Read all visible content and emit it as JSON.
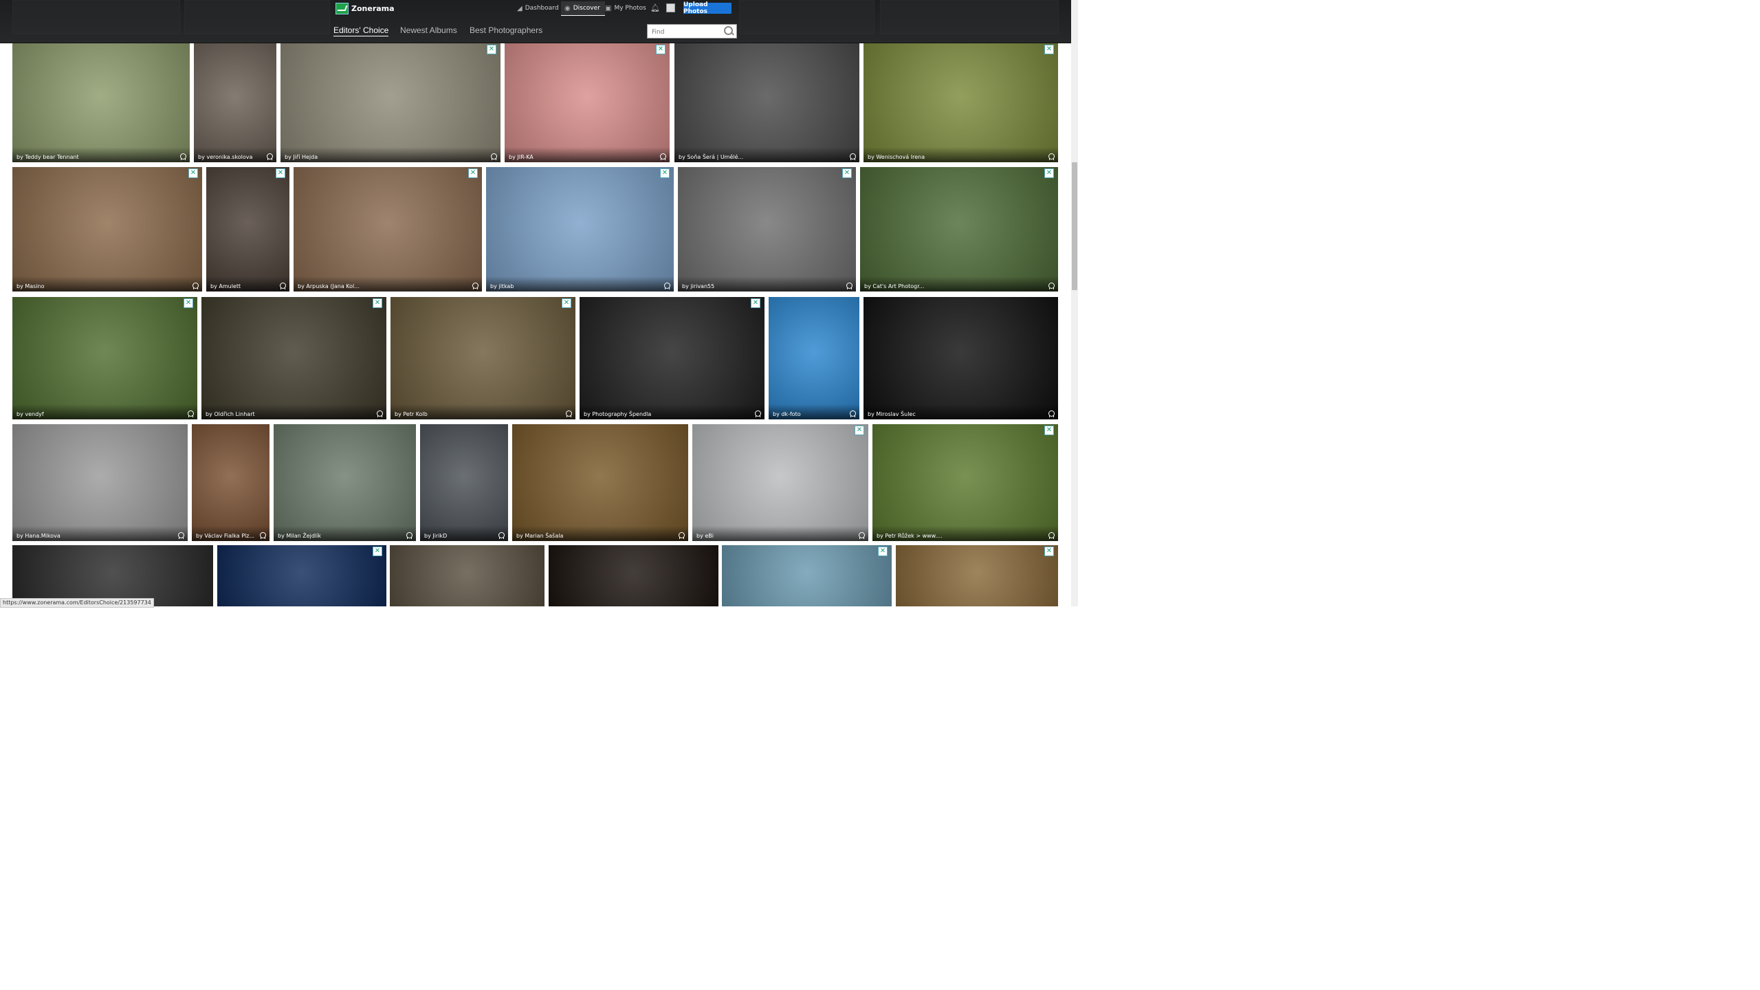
{
  "header": {
    "logo_text": "Zonerama",
    "nav": {
      "dashboard": "Dashboard",
      "discover": "Discover",
      "my_photos": "My Photos"
    },
    "upload_label": "Upload Photos",
    "tabs": {
      "editors": "Editors' Choice",
      "newest": "Newest Albums",
      "best": "Best Photographers"
    },
    "search_placeholder": "Find"
  },
  "tiles": [
    {
      "by": "by Teddy bear Tennant",
      "color": "#8b9b6a"
    },
    {
      "by": "by veronika.skolova",
      "color": "#6a5f55"
    },
    {
      "by": "by Jiří Hejda",
      "color": "#8f8a78"
    },
    {
      "by": "by JIR-KA",
      "color": "#d98d8a"
    },
    {
      "by": "by Soňa Šerá | Umělé...",
      "color": "#4a4a4a"
    },
    {
      "by": "by Wenischová Irena",
      "color": "#7a8a3a"
    },
    {
      "by": "by Masino",
      "color": "#8b6a4a"
    },
    {
      "by": "by Amulett",
      "color": "#4a3e36"
    },
    {
      "by": "by Arpuska (Jana Kol...",
      "color": "#8a6a4f"
    },
    {
      "by": "by jitkab",
      "color": "#7aa0c8"
    },
    {
      "by": "by jirivan55",
      "color": "#6f6f6f"
    },
    {
      "by": "by Cat's Art Photogr...",
      "color": "#4d6b36"
    },
    {
      "by": "by vendyf",
      "color": "#4f6e2f"
    },
    {
      "by": "by Oldřich Linhart",
      "color": "#3e3a2a"
    },
    {
      "by": "by Petr Kolb",
      "color": "#6a5a3a"
    },
    {
      "by": "by Photography Špendla",
      "color": "#1e1e1e"
    },
    {
      "by": "by dk-foto",
      "color": "#2a86d0"
    },
    {
      "by": "by Miroslav Šulec",
      "color": "#0f0f0f"
    },
    {
      "by": "by Hana.Mikova",
      "color": "#9a9a9a"
    },
    {
      "by": "by Václav Fialka Plz...",
      "color": "#7a5032"
    },
    {
      "by": "by Milan Žejdlík",
      "color": "#6b7a6a"
    },
    {
      "by": "by JirikD",
      "color": "#4a5056"
    },
    {
      "by": "by Marian Šašala",
      "color": "#7a5a2a"
    },
    {
      "by": "by eBi",
      "color": "#b9bcbe"
    },
    {
      "by": "by Petr Růžek > www....",
      "color": "#5c7a2e"
    },
    {
      "by": "",
      "color": "#2a2a2a"
    },
    {
      "by": "",
      "color": "#0f2a5a"
    },
    {
      "by": "",
      "color": "#5a5040"
    },
    {
      "by": "",
      "color": "#1c1410"
    },
    {
      "by": "",
      "color": "#6a9ab0"
    },
    {
      "by": "",
      "color": "#8a6a3a"
    }
  ],
  "status_url": "https://www.zonerama.com/EditorsChoice/213597734"
}
